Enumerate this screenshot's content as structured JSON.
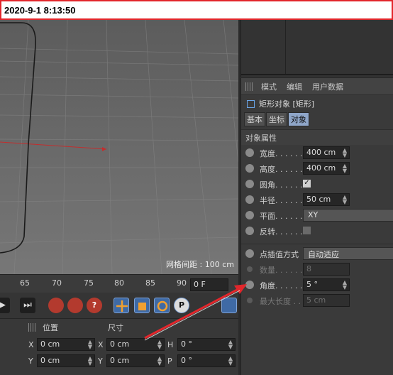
{
  "window": {
    "title": "2020-9-1 8:13:50"
  },
  "viewport": {
    "grid_spacing": "网格间距 : 100 cm"
  },
  "attr_menu": {
    "items": [
      "模式",
      "编辑",
      "用户数据"
    ]
  },
  "object": {
    "title": "矩形对象 [矩形]"
  },
  "tabs": [
    {
      "label": "基本",
      "active": false
    },
    {
      "label": "坐标",
      "active": false
    },
    {
      "label": "对象",
      "active": true
    }
  ],
  "section": {
    "title": "对象属性"
  },
  "props": {
    "width": {
      "label": "宽度. . . . . . .",
      "value": "400 cm"
    },
    "height": {
      "label": "高度. . . . . . .",
      "value": "400 cm"
    },
    "rounding": {
      "label": "圆角. . . . . . .",
      "checked": true
    },
    "radius": {
      "label": "半径. . . . . . .",
      "value": "50 cm"
    },
    "plane": {
      "label": "平面. . . . . . .",
      "value": "XY"
    },
    "reverse": {
      "label": "反转. . . . . . .",
      "checked": false
    },
    "interp": {
      "label": "点插值方式",
      "value": "自动适应"
    },
    "number": {
      "label": "数量. . . . . . .",
      "value": "8"
    },
    "angle": {
      "label": "角度. . . . . . .",
      "value": "5 °"
    },
    "max_length": {
      "label": "最大长度 . .",
      "value": "5 cm"
    }
  },
  "timeline": {
    "ticks": [
      "65",
      "70",
      "75",
      "80",
      "85",
      "90"
    ],
    "frame": "0 F"
  },
  "coord": {
    "headers": [
      "位置",
      "尺寸"
    ],
    "rows": [
      {
        "axis": "X",
        "pos": "0 cm",
        "size_axis": "X",
        "size": "0 cm",
        "rot_axis": "H",
        "rot": "0 °"
      },
      {
        "axis": "Y",
        "pos": "0 cm",
        "size_axis": "Y",
        "size": "0 cm",
        "rot_axis": "P",
        "rot": "0 °"
      }
    ]
  },
  "colors": {
    "annotation_arrow": "#e2262b",
    "title_border": "#e2262b",
    "active_tab": "#8fa6c9",
    "x_axis": "#c22e2e"
  },
  "icons": [
    "grip-icon",
    "object-square-icon",
    "radio-icon",
    "checkbox-icon",
    "play-icon",
    "end-icon",
    "record-icon",
    "autokey-icon",
    "help-icon",
    "move-icon",
    "scale-icon",
    "rotate-icon",
    "param-icon"
  ]
}
